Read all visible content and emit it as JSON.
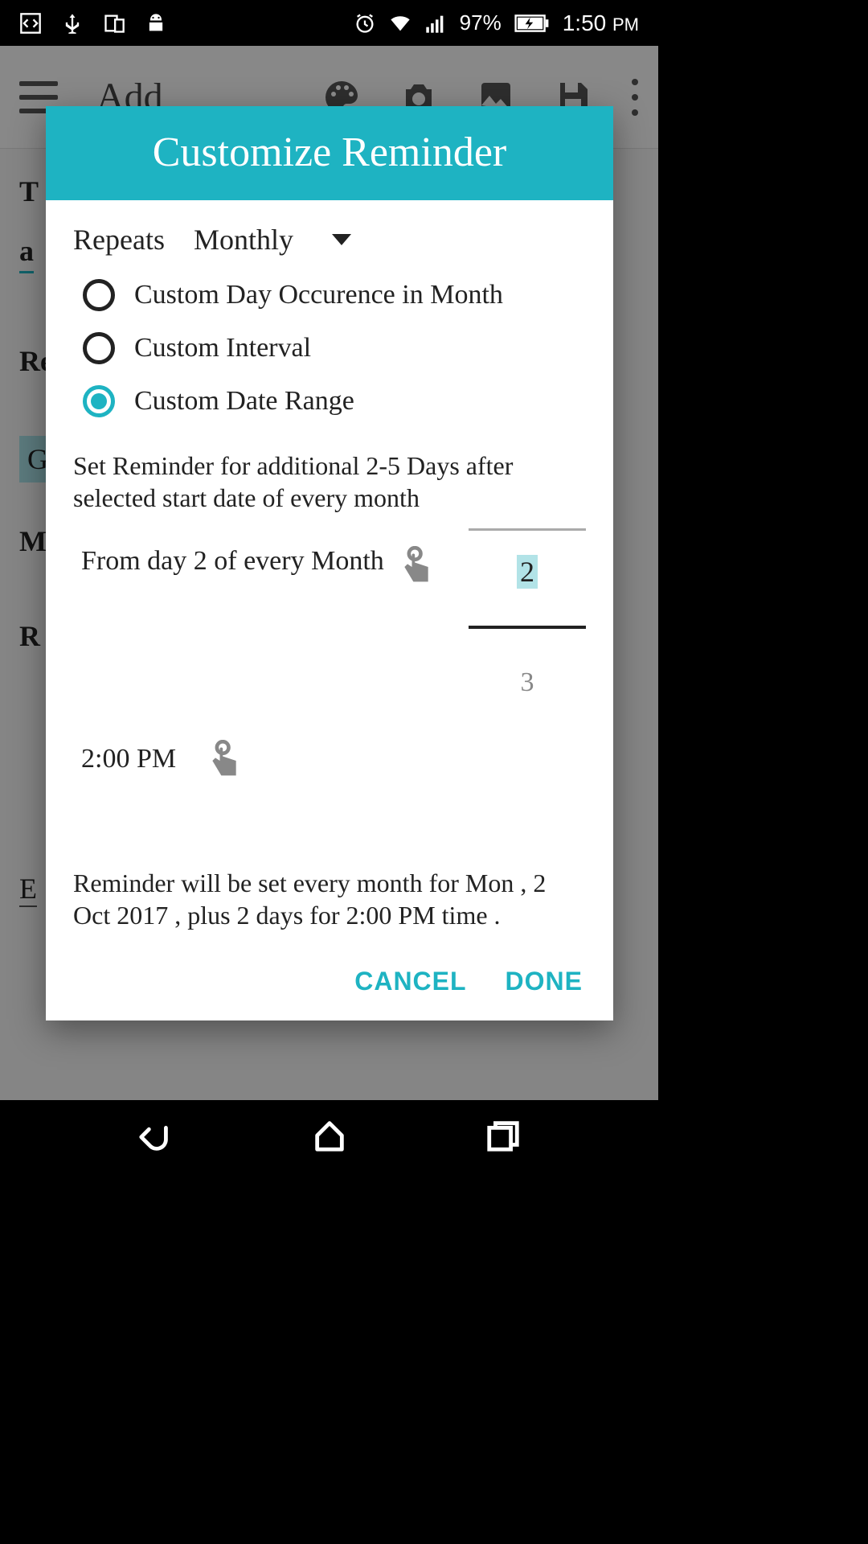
{
  "status": {
    "battery": "97%",
    "time": "1:50",
    "ampm": "PM"
  },
  "background": {
    "title": "Add",
    "t_line": "T",
    "a_line": "a",
    "re_line": "Re",
    "g_line": "G",
    "m_line": "M",
    "r_line": "R",
    "e_line": "E"
  },
  "dialog": {
    "title": "Customize Reminder",
    "repeats_label": "Repeats",
    "repeats_value": "Monthly",
    "options": {
      "opt1": "Custom Day Occurence in Month",
      "opt2": "Custom Interval",
      "opt3": "Custom Date Range"
    },
    "helper": "Set Reminder for additional 2-5 Days after selected start date of every month",
    "from_day": "From day 2 of every Month",
    "picker_value": "2",
    "picker_next": "3",
    "time": "2:00 PM",
    "summary": "Reminder will be set every month for Mon , 2 Oct 2017 , plus 2 days for 2:00 PM time .",
    "cancel": "CANCEL",
    "done": "DONE"
  }
}
